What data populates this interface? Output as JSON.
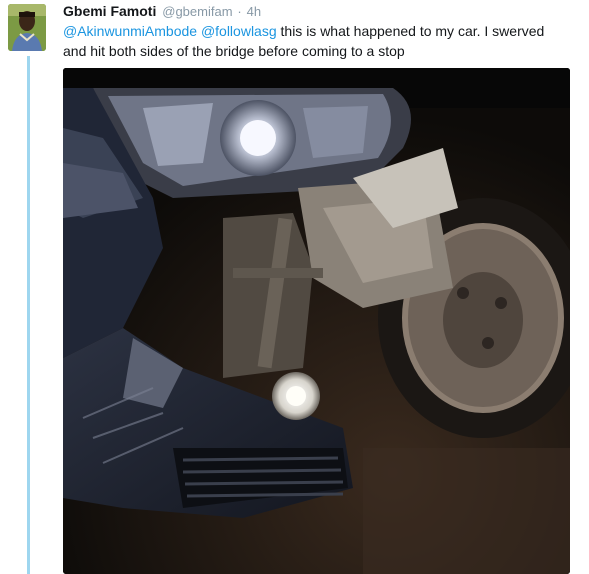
{
  "tweet": {
    "author_name": "Gbemi Famoti",
    "author_handle": "@gbemifam",
    "separator": "·",
    "timestamp": "4h",
    "mention_1": "@AkinwunmiAmbode",
    "mention_2": "@followlasg",
    "text_line_1": " this is what happened to my car. I swerved",
    "text_line_2": "and hit both sides of the bridge before coming to a stop",
    "media_icon": "damaged-car-photo"
  },
  "colors": {
    "link": "#1b95e0",
    "muted": "#8899a6",
    "text": "#14171a",
    "thread_line": "#9ed6ef"
  }
}
